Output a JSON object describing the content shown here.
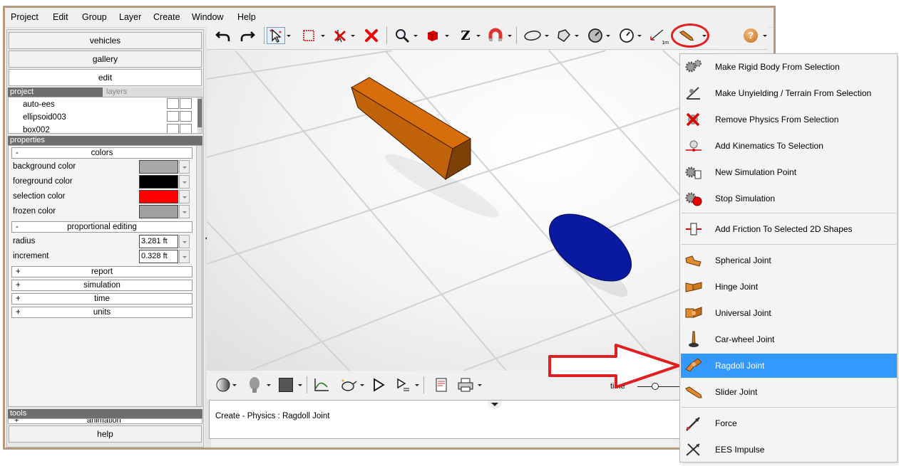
{
  "menubar": [
    "Project",
    "Edit",
    "Group",
    "Layer",
    "Create",
    "Window",
    "Help"
  ],
  "left_panel": {
    "tabs": [
      "vehicles",
      "gallery",
      "edit"
    ],
    "active_tab": "edit",
    "project_header": "project",
    "layers_header": "layers",
    "project_items": [
      "auto-ees",
      "ellipsoid003",
      "box002"
    ],
    "properties_header": "properties",
    "colors_section": {
      "sign": "-",
      "title": "colors"
    },
    "colors": [
      {
        "label": "background color",
        "value": "#a9a9a9"
      },
      {
        "label": "foreground color",
        "value": "#000000"
      },
      {
        "label": "selection color",
        "value": "#ff0000"
      },
      {
        "label": "frozen color",
        "value": "#a0a0a0"
      }
    ],
    "prop_edit_section": {
      "sign": "-",
      "title": "proportional editing"
    },
    "radius": {
      "label": "radius",
      "value": "3.281 ft"
    },
    "increment": {
      "label": "increment",
      "value": "0.328 ft"
    },
    "collapsed_sections": [
      {
        "sign": "+",
        "title": "report"
      },
      {
        "sign": "+",
        "title": "simulation"
      },
      {
        "sign": "+",
        "title": "time"
      },
      {
        "sign": "+",
        "title": "units"
      }
    ],
    "tools_header": "tools",
    "tools_item": {
      "sign": "+",
      "title": "animation"
    },
    "help_button": "help"
  },
  "toolbar": {
    "z_label": "Z",
    "measure_label": "1m",
    "help_label": "?"
  },
  "viewport": {
    "box_color": "#c0620a",
    "ellipsoid_color": "#0a1aa0"
  },
  "bottom": {
    "time_label": "time",
    "status": "Create - Physics : Ragdoll Joint"
  },
  "menu": {
    "highlight_color": "#3399ff",
    "items": [
      {
        "label": "Make Rigid Body From Selection",
        "icon": "gears-icon"
      },
      {
        "label": "Make Unyielding / Terrain From Selection",
        "icon": "terrain-icon"
      },
      {
        "label": "Remove Physics From Selection",
        "icon": "remove-physics-icon"
      },
      {
        "label": "Add Kinematics To Selection",
        "icon": "kinematics-icon"
      },
      {
        "label": "New Simulation Point",
        "icon": "new-sim-point-icon"
      },
      {
        "label": "Stop Simulation",
        "icon": "stop-simulation-icon"
      },
      {
        "label": "Add Friction To Selected 2D Shapes",
        "icon": "friction-icon"
      },
      {
        "label": "Spherical Joint",
        "icon": "spherical-joint-icon"
      },
      {
        "label": "Hinge Joint",
        "icon": "hinge-joint-icon"
      },
      {
        "label": "Universal Joint",
        "icon": "universal-joint-icon"
      },
      {
        "label": "Car-wheel Joint",
        "icon": "car-wheel-joint-icon"
      },
      {
        "label": "Ragdoll Joint",
        "icon": "ragdoll-joint-icon"
      },
      {
        "label": "Slider Joint",
        "icon": "slider-joint-icon"
      },
      {
        "label": "Force",
        "icon": "force-icon"
      },
      {
        "label": "EES Impulse",
        "icon": "impulse-icon"
      }
    ]
  }
}
